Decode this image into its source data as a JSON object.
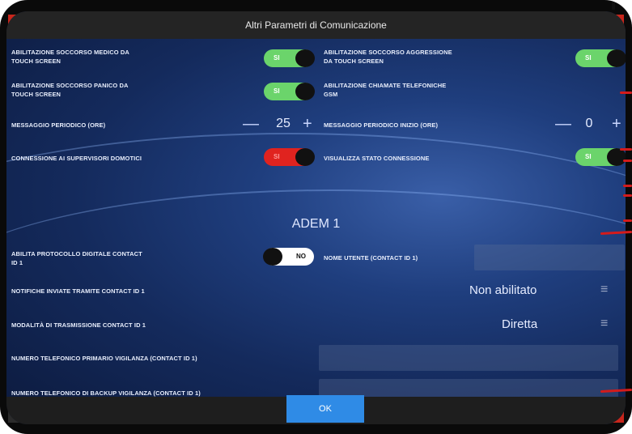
{
  "window": {
    "title": "Altri Parametri di Comunicazione"
  },
  "settings": {
    "soccorso_medico": {
      "label_line1": "ABILITAZIONE SOCCORSO MEDICO DA",
      "label_line2": "TOUCH SCREEN",
      "toggle": "SI",
      "state": "on"
    },
    "soccorso_aggressione": {
      "label_line1": "ABILITAZIONE SOCCORSO AGGRESSIONE",
      "label_line2": "DA TOUCH SCREEN",
      "toggle": "SI",
      "state": "on"
    },
    "soccorso_panico": {
      "label_line1": "ABILITAZIONE SOCCORSO PANICO DA",
      "label_line2": "TOUCH SCREEN",
      "toggle": "SI",
      "state": "on"
    },
    "chiamate_gsm": {
      "label_line1": "ABILITAZIONE CHIAMATE TELEFONICHE",
      "label_line2": "GSM"
    },
    "messaggio_periodico": {
      "label": "MESSAGGIO PERIODICO (ORE)",
      "value": "25"
    },
    "messaggio_periodico_inizio": {
      "label": "MESSAGGIO PERIODICO INIZIO (ORE)",
      "value": "0"
    },
    "connessione_supervisori": {
      "label": "CONNESSIONE AI SUPERVISORI DOMOTICI",
      "toggle": "SI",
      "state": "on",
      "color": "#e0231f"
    },
    "visualizza_stato": {
      "label": "VISUALIZZA STATO CONNESSIONE",
      "toggle": "SI",
      "state": "on"
    }
  },
  "adem": {
    "section_title": "ADEM 1",
    "protocollo": {
      "label_line1": "ABILITA PROTOCOLLO DIGITALE CONTACT",
      "label_line2": "ID 1",
      "toggle": "NO",
      "state": "off"
    },
    "nome_utente": {
      "label": "NOME UTENTE (CONTACT ID 1)",
      "value": ""
    },
    "notifiche": {
      "label": "NOTIFICHE INVIATE TRAMITE CONTACT ID 1",
      "value": "Non abilitato"
    },
    "modalita": {
      "label": "MODALITÀ DI TRASMISSIONE CONTACT ID 1",
      "value": "Diretta"
    },
    "telefono_primario": {
      "label": "NUMERO TELEFONICO PRIMARIO VIGILANZA (CONTACT ID 1)",
      "value": ""
    },
    "telefono_backup": {
      "label": "NUMERO TELEFONICO DI BACKUP VIGILANZA (CONTACT ID 1)",
      "value": ""
    }
  },
  "stepper_symbols": {
    "minus": "—",
    "plus": "+"
  },
  "menu_icon_glyph": "≡",
  "footer": {
    "ok_label": "OK"
  },
  "colors": {
    "toggle_on": "#6bd46b",
    "toggle_red": "#e0231f",
    "ok_button": "#2f8be6",
    "titlebar": "#242424"
  }
}
